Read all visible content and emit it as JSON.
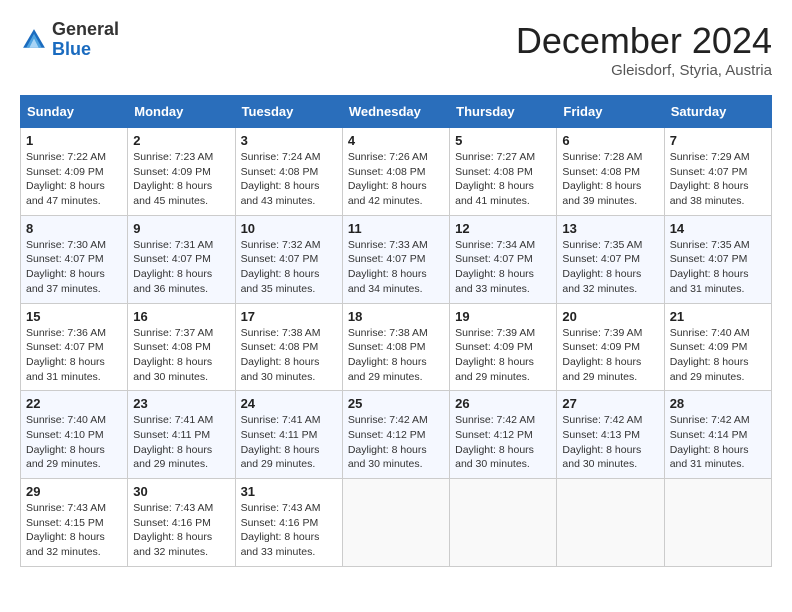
{
  "header": {
    "logo": {
      "general": "General",
      "blue": "Blue"
    },
    "title": "December 2024",
    "subtitle": "Gleisdorf, Styria, Austria"
  },
  "calendar": {
    "days_of_week": [
      "Sunday",
      "Monday",
      "Tuesday",
      "Wednesday",
      "Thursday",
      "Friday",
      "Saturday"
    ],
    "weeks": [
      [
        null,
        null,
        null,
        null,
        null,
        null,
        null
      ]
    ],
    "cells": [
      {
        "day": 1,
        "col": 0,
        "sunrise": "7:22 AM",
        "sunset": "4:09 PM",
        "daylight": "8 hours and 47 minutes."
      },
      {
        "day": 2,
        "col": 1,
        "sunrise": "7:23 AM",
        "sunset": "4:09 PM",
        "daylight": "8 hours and 45 minutes."
      },
      {
        "day": 3,
        "col": 2,
        "sunrise": "7:24 AM",
        "sunset": "4:08 PM",
        "daylight": "8 hours and 43 minutes."
      },
      {
        "day": 4,
        "col": 3,
        "sunrise": "7:26 AM",
        "sunset": "4:08 PM",
        "daylight": "8 hours and 42 minutes."
      },
      {
        "day": 5,
        "col": 4,
        "sunrise": "7:27 AM",
        "sunset": "4:08 PM",
        "daylight": "8 hours and 41 minutes."
      },
      {
        "day": 6,
        "col": 5,
        "sunrise": "7:28 AM",
        "sunset": "4:08 PM",
        "daylight": "8 hours and 39 minutes."
      },
      {
        "day": 7,
        "col": 6,
        "sunrise": "7:29 AM",
        "sunset": "4:07 PM",
        "daylight": "8 hours and 38 minutes."
      },
      {
        "day": 8,
        "col": 0,
        "sunrise": "7:30 AM",
        "sunset": "4:07 PM",
        "daylight": "8 hours and 37 minutes."
      },
      {
        "day": 9,
        "col": 1,
        "sunrise": "7:31 AM",
        "sunset": "4:07 PM",
        "daylight": "8 hours and 36 minutes."
      },
      {
        "day": 10,
        "col": 2,
        "sunrise": "7:32 AM",
        "sunset": "4:07 PM",
        "daylight": "8 hours and 35 minutes."
      },
      {
        "day": 11,
        "col": 3,
        "sunrise": "7:33 AM",
        "sunset": "4:07 PM",
        "daylight": "8 hours and 34 minutes."
      },
      {
        "day": 12,
        "col": 4,
        "sunrise": "7:34 AM",
        "sunset": "4:07 PM",
        "daylight": "8 hours and 33 minutes."
      },
      {
        "day": 13,
        "col": 5,
        "sunrise": "7:35 AM",
        "sunset": "4:07 PM",
        "daylight": "8 hours and 32 minutes."
      },
      {
        "day": 14,
        "col": 6,
        "sunrise": "7:35 AM",
        "sunset": "4:07 PM",
        "daylight": "8 hours and 31 minutes."
      },
      {
        "day": 15,
        "col": 0,
        "sunrise": "7:36 AM",
        "sunset": "4:07 PM",
        "daylight": "8 hours and 31 minutes."
      },
      {
        "day": 16,
        "col": 1,
        "sunrise": "7:37 AM",
        "sunset": "4:08 PM",
        "daylight": "8 hours and 30 minutes."
      },
      {
        "day": 17,
        "col": 2,
        "sunrise": "7:38 AM",
        "sunset": "4:08 PM",
        "daylight": "8 hours and 30 minutes."
      },
      {
        "day": 18,
        "col": 3,
        "sunrise": "7:38 AM",
        "sunset": "4:08 PM",
        "daylight": "8 hours and 29 minutes."
      },
      {
        "day": 19,
        "col": 4,
        "sunrise": "7:39 AM",
        "sunset": "4:09 PM",
        "daylight": "8 hours and 29 minutes."
      },
      {
        "day": 20,
        "col": 5,
        "sunrise": "7:39 AM",
        "sunset": "4:09 PM",
        "daylight": "8 hours and 29 minutes."
      },
      {
        "day": 21,
        "col": 6,
        "sunrise": "7:40 AM",
        "sunset": "4:09 PM",
        "daylight": "8 hours and 29 minutes."
      },
      {
        "day": 22,
        "col": 0,
        "sunrise": "7:40 AM",
        "sunset": "4:10 PM",
        "daylight": "8 hours and 29 minutes."
      },
      {
        "day": 23,
        "col": 1,
        "sunrise": "7:41 AM",
        "sunset": "4:11 PM",
        "daylight": "8 hours and 29 minutes."
      },
      {
        "day": 24,
        "col": 2,
        "sunrise": "7:41 AM",
        "sunset": "4:11 PM",
        "daylight": "8 hours and 29 minutes."
      },
      {
        "day": 25,
        "col": 3,
        "sunrise": "7:42 AM",
        "sunset": "4:12 PM",
        "daylight": "8 hours and 30 minutes."
      },
      {
        "day": 26,
        "col": 4,
        "sunrise": "7:42 AM",
        "sunset": "4:12 PM",
        "daylight": "8 hours and 30 minutes."
      },
      {
        "day": 27,
        "col": 5,
        "sunrise": "7:42 AM",
        "sunset": "4:13 PM",
        "daylight": "8 hours and 30 minutes."
      },
      {
        "day": 28,
        "col": 6,
        "sunrise": "7:42 AM",
        "sunset": "4:14 PM",
        "daylight": "8 hours and 31 minutes."
      },
      {
        "day": 29,
        "col": 0,
        "sunrise": "7:43 AM",
        "sunset": "4:15 PM",
        "daylight": "8 hours and 32 minutes."
      },
      {
        "day": 30,
        "col": 1,
        "sunrise": "7:43 AM",
        "sunset": "4:16 PM",
        "daylight": "8 hours and 32 minutes."
      },
      {
        "day": 31,
        "col": 2,
        "sunrise": "7:43 AM",
        "sunset": "4:16 PM",
        "daylight": "8 hours and 33 minutes."
      }
    ],
    "labels": {
      "sunrise": "Sunrise:",
      "sunset": "Sunset:",
      "daylight": "Daylight:"
    }
  }
}
